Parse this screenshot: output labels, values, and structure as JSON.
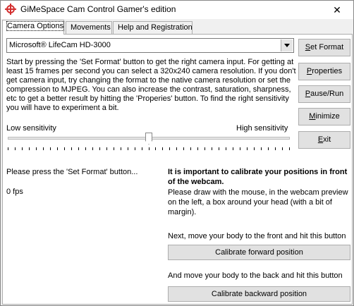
{
  "window": {
    "title": "GiMeSpace Cam Control Gamer's edition",
    "close_glyph": "✕"
  },
  "tabs": [
    {
      "label": "Camera Options",
      "active": true
    },
    {
      "label": "Movements",
      "active": false
    },
    {
      "label": "Help and Registration",
      "active": false
    }
  ],
  "camera": {
    "selected": "Microsoft® LifeCam HD-3000",
    "intro": "Start by pressing the 'Set Format' button to get the right camera input. For getting at least 15 frames per second you can select a 320x240 camera resolution. If you don't get camera input, try changing the format to the native camera resolution or set the compression to MJPEG. You can also increase the contrast, saturation, sharpness, etc to get a better result by hitting the 'Properies' button. To find the right sensitivity you will have to experiment a bit."
  },
  "buttons": {
    "set_format": {
      "mnemonic": "S",
      "rest": "et Format"
    },
    "properties": {
      "mnemonic": "P",
      "rest": "roperties"
    },
    "pause_run": {
      "mnemonic": "P",
      "rest": "ause/Run"
    },
    "minimize": {
      "mnemonic": "M",
      "rest": "inimize"
    },
    "exit": {
      "mnemonic": "E",
      "rest": "xit"
    }
  },
  "sensitivity": {
    "low_label": "Low sensitivity",
    "high_label": "High sensitivity",
    "level": 0.5,
    "ticks": 41
  },
  "status": {
    "message": "Please press the 'Set Format' button...",
    "fps": "0 fps"
  },
  "calibration": {
    "heading": "It is important to calibrate your positions in front of the webcam.",
    "instruction": "Please draw with the mouse, in the webcam preview on the left, a box around your head (with a bit of margin).",
    "front_text": "Next, move your body to the front and hit this button",
    "forward_button": "Calibrate forward position",
    "back_text": "And move your body to the back and hit this button",
    "backward_button": "Calibrate backward position"
  },
  "colors": {
    "icon_red": "#d32f2f",
    "button_face": "#e1e1e1",
    "window_bg": "#f0f0f0"
  }
}
